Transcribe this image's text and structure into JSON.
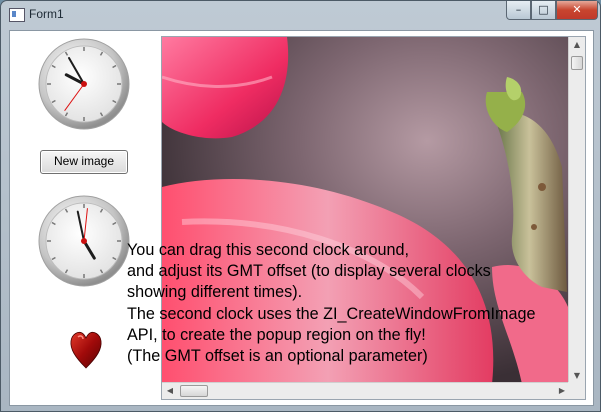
{
  "window": {
    "title": "Form1",
    "minimize_glyph": "–",
    "maximize_glyph": "□",
    "close_glyph": "✕"
  },
  "controls": {
    "new_image_label": "New image"
  },
  "icons": {
    "clock_1": "analog-clock-icon",
    "clock_2": "analog-clock-icon",
    "heart": "heart-icon"
  },
  "clock_1": {
    "hour": 9,
    "minute": 55,
    "second": 36
  },
  "clock_2": {
    "hour": 4,
    "minute": 58,
    "second": 1
  },
  "message": {
    "lines": [
      "You can drag this second clock around,",
      "and adjust its GMT offset (to display several clocks",
      "showing different times).",
      "The second clock uses the ZI_CreateWindowFromImage",
      "API, to create the popup region on the fly!",
      "(The GMT offset is an optional parameter)"
    ]
  },
  "colors": {
    "accent_close": "#c0392b",
    "heart": "#a10a0a"
  }
}
